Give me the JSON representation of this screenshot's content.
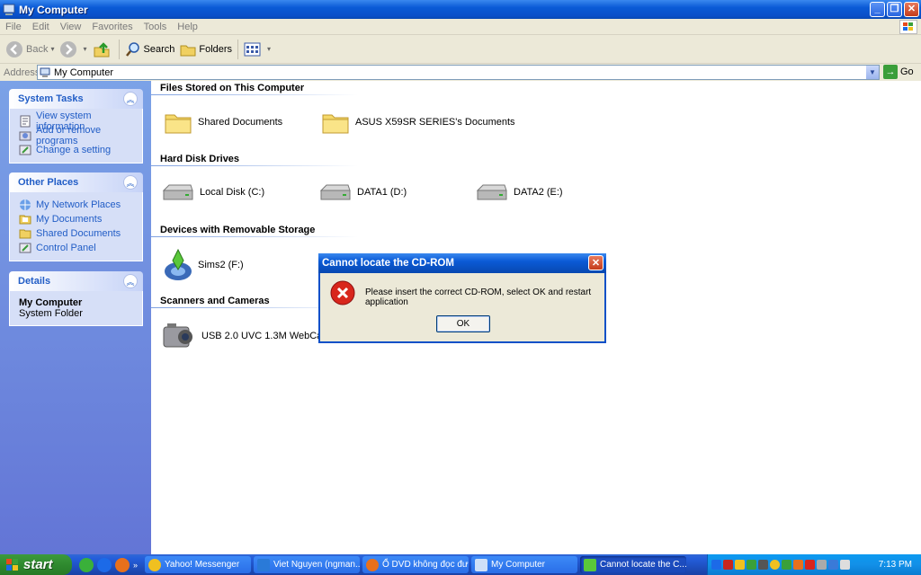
{
  "window": {
    "title": "My Computer"
  },
  "menu": [
    "File",
    "Edit",
    "View",
    "Favorites",
    "Tools",
    "Help"
  ],
  "toolbar": {
    "back": "Back",
    "search": "Search",
    "folders": "Folders"
  },
  "address": {
    "label": "Address",
    "value": "My Computer",
    "go": "Go"
  },
  "sidebar": {
    "system_tasks": {
      "title": "System Tasks",
      "items": [
        "View system information",
        "Add or remove programs",
        "Change a setting"
      ]
    },
    "other_places": {
      "title": "Other Places",
      "items": [
        "My Network Places",
        "My Documents",
        "Shared Documents",
        "Control Panel"
      ]
    },
    "details": {
      "title": "Details",
      "name": "My Computer",
      "type": "System Folder"
    }
  },
  "groups": {
    "files": {
      "title": "Files Stored on This Computer",
      "items": [
        "Shared Documents",
        "ASUS X59SR SERIES's Documents"
      ]
    },
    "drives": {
      "title": "Hard Disk Drives",
      "items": [
        "Local Disk (C:)",
        "DATA1 (D:)",
        "DATA2 (E:)"
      ]
    },
    "removable": {
      "title": "Devices with Removable Storage",
      "items": [
        "Sims2 (F:)"
      ]
    },
    "scanners": {
      "title": "Scanners and Cameras",
      "items": [
        "USB 2.0 UVC 1.3M WebCam"
      ]
    }
  },
  "dialog": {
    "title": "Cannot locate the CD-ROM",
    "message": "Please insert the correct CD-ROM, select OK and restart application",
    "ok": "OK"
  },
  "taskbar": {
    "start": "start",
    "more": "»",
    "tasks": [
      "Yahoo! Messenger",
      "Viet Nguyen (ngman...",
      "Ổ DVD không đọc đư...",
      "My Computer",
      "Cannot locate the C..."
    ],
    "clock": "7:13 PM"
  },
  "colors": {
    "accent": "#0a5ad6",
    "sidebar": "#6375d6",
    "link": "#215dc6"
  }
}
